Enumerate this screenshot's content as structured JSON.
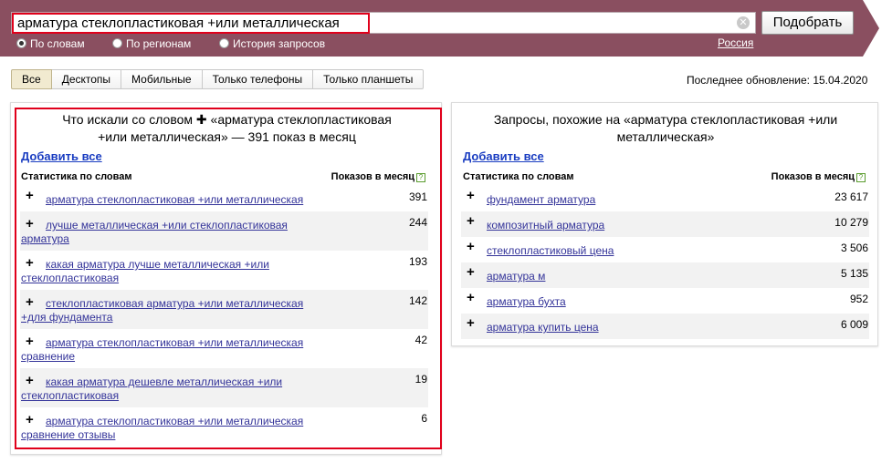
{
  "search": {
    "query": "арматура стеклопластиковая +или металлическая",
    "submit_label": "Подобрать",
    "clear_symbol": "✕"
  },
  "modes": [
    {
      "label": "По словам",
      "selected": true
    },
    {
      "label": "По регионам",
      "selected": false
    },
    {
      "label": "История запросов",
      "selected": false
    }
  ],
  "region": "Россия",
  "tabs": [
    {
      "label": "Все",
      "active": true
    },
    {
      "label": "Десктопы",
      "active": false
    },
    {
      "label": "Мобильные",
      "active": false
    },
    {
      "label": "Только телефоны",
      "active": false
    },
    {
      "label": "Только планшеты",
      "active": false
    }
  ],
  "last_update": "Последнее обновление: 15.04.2020",
  "left_panel": {
    "title_part1": "Что искали со словом",
    "title_plus": "✚",
    "title_part2": "«арматура стеклопластиковая",
    "title_line2": "+или металлическая» — 391 показ в месяц",
    "add_all": "Добавить все",
    "col_phrase": "Статистика по словам",
    "col_count": "Показов в месяц",
    "help": "?",
    "rows": [
      {
        "line1": "арматура стеклопластиковая +или металлическая",
        "line2": "",
        "count": "391"
      },
      {
        "line1": "лучше металлическая +или стеклопластиковая",
        "line2": "арматура",
        "count": "244"
      },
      {
        "line1": "какая арматура лучше металлическая +или",
        "line2": "стеклопластиковая",
        "count": "193"
      },
      {
        "line1": "стеклопластиковая арматура +или металлическая",
        "line2": "+для фундамента",
        "count": "142"
      },
      {
        "line1": "арматура стеклопластиковая +или металлическая",
        "line2": "сравнение",
        "count": "42"
      },
      {
        "line1": "какая арматура дешевле металлическая +или",
        "line2": "стеклопластиковая",
        "count": "19"
      },
      {
        "line1": "арматура стеклопластиковая +или металлическая",
        "line2": "сравнение отзывы",
        "count": "6"
      }
    ]
  },
  "right_panel": {
    "title_line1": "Запросы, похожие на «арматура стеклопластиковая +или",
    "title_line2": "металлическая»",
    "add_all": "Добавить все",
    "col_phrase": "Статистика по словам",
    "col_count": "Показов в месяц",
    "help": "?",
    "rows": [
      {
        "line1": "фундамент арматура",
        "count": "23 617"
      },
      {
        "line1": "композитный арматура",
        "count": "10 279"
      },
      {
        "line1": "стеклопластиковый цена",
        "count": "3 506"
      },
      {
        "line1": "арматура м",
        "count": "5 135"
      },
      {
        "line1": "арматура бухта",
        "count": "952"
      },
      {
        "line1": "арматура купить цена",
        "count": "6 009"
      }
    ]
  },
  "colors": {
    "header": "#8a4f60",
    "highlight": "#e0001b",
    "link": "#333399",
    "add_all": "#1a3dc1"
  }
}
